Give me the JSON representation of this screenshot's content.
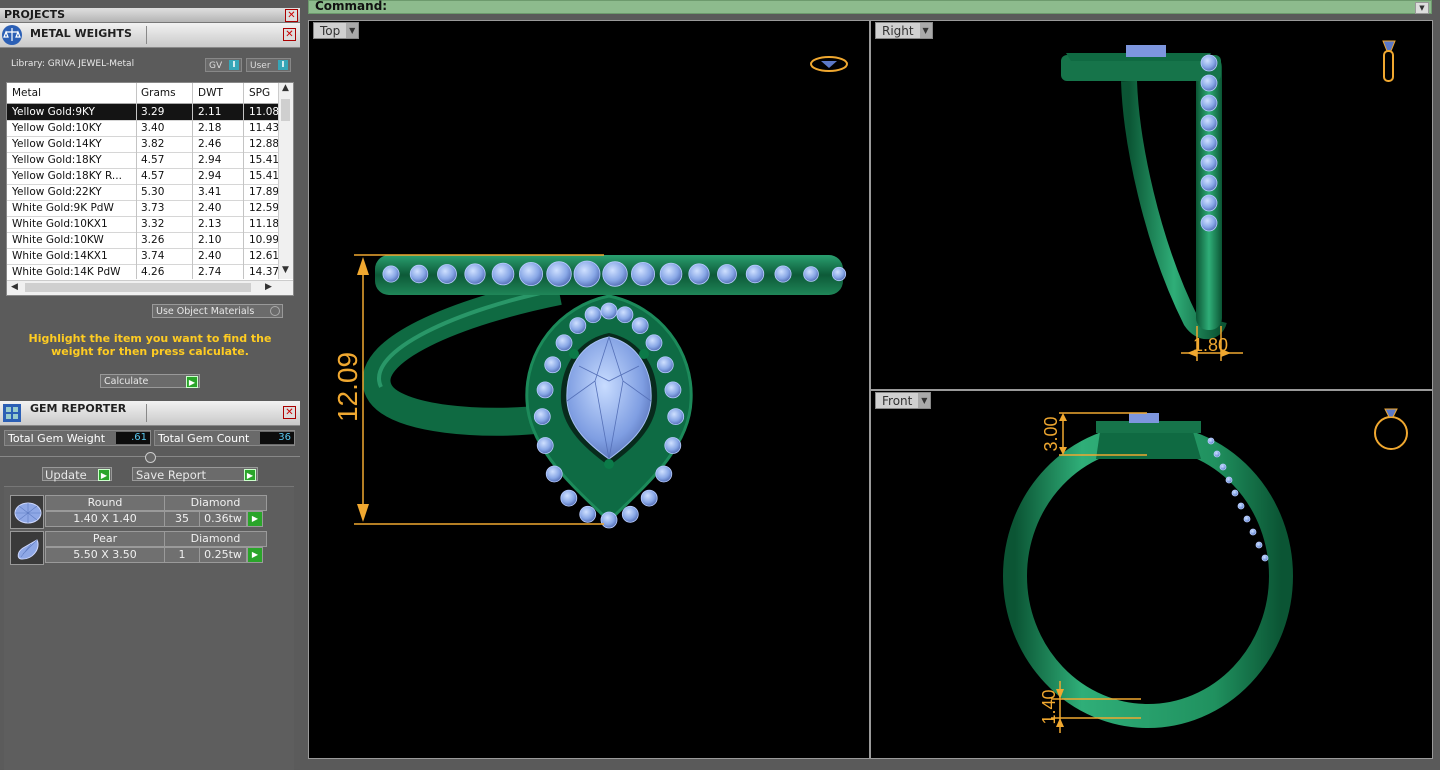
{
  "projects": {
    "title": "PROJECTS"
  },
  "metal_weights": {
    "title": "METAL WEIGHTS",
    "library": "Library: GRIVA JEWEL-Metal",
    "toggle_gv": "GV",
    "toggle_user": "User",
    "columns": [
      "Metal",
      "Grams",
      "DWT",
      "SPG"
    ],
    "rows": [
      [
        "Yellow Gold:9KY",
        "3.29",
        "2.11",
        "11.08"
      ],
      [
        "Yellow Gold:10KY",
        "3.40",
        "2.18",
        "11.43"
      ],
      [
        "Yellow Gold:14KY",
        "3.82",
        "2.46",
        "12.88"
      ],
      [
        "Yellow Gold:18KY",
        "4.57",
        "2.94",
        "15.41"
      ],
      [
        "Yellow Gold:18KY R...",
        "4.57",
        "2.94",
        "15.41"
      ],
      [
        "Yellow Gold:22KY",
        "5.30",
        "3.41",
        "17.89"
      ],
      [
        "White Gold:9K PdW",
        "3.73",
        "2.40",
        "12.59"
      ],
      [
        "White Gold:10KX1",
        "3.32",
        "2.13",
        "11.18"
      ],
      [
        "White Gold:10KW",
        "3.26",
        "2.10",
        "10.99"
      ],
      [
        "White Gold:14KX1",
        "3.74",
        "2.40",
        "12.61"
      ],
      [
        "White Gold:14K PdW",
        "4.26",
        "2.74",
        "14.37"
      ]
    ],
    "use_object_materials": "Use Object Materials",
    "instruction": "Highlight the item you want to find the weight for then press calculate.",
    "calculate": "Calculate"
  },
  "gem_reporter": {
    "title": "GEM REPORTER",
    "total_weight_label": "Total Gem Weight",
    "total_weight_value": ".61",
    "total_count_label": "Total Gem Count",
    "total_count_value": "36",
    "update": "Update",
    "save_report": "Save Report",
    "gems": [
      {
        "icon": "round-gem-icon",
        "shape": "Round",
        "type": "Diamond",
        "size": "1.40 X 1.40",
        "count": "35",
        "weight": "0.36tw"
      },
      {
        "icon": "pear-gem-icon",
        "shape": "Pear",
        "type": "Diamond",
        "size": "5.50 X 3.50",
        "count": "1",
        "weight": "0.25tw"
      }
    ]
  },
  "command": {
    "label": "Command:"
  },
  "viewports": {
    "top": {
      "label": "Top",
      "dimension": "12.09"
    },
    "right": {
      "label": "Right",
      "dimension": "1.80"
    },
    "front": {
      "label": "Front",
      "dimension_top": "3.00",
      "dimension_bottom": "1.40"
    }
  },
  "colors": {
    "metal": "#1e7a52",
    "gem": "#8fb0ee",
    "dimension": "#f0a830",
    "selection": "#141414",
    "command_bar": "#8dbb8d"
  }
}
